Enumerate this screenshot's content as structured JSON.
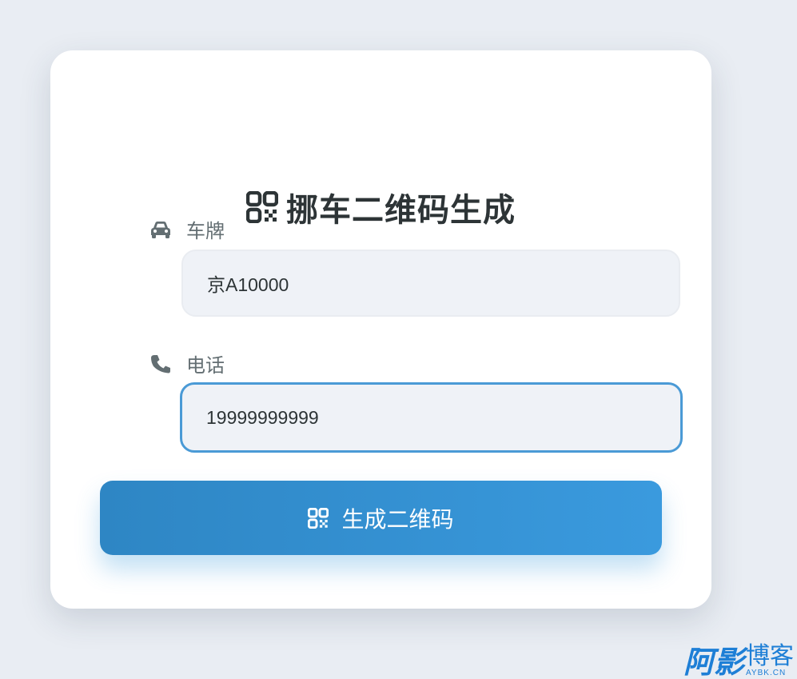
{
  "form": {
    "title": "挪车二维码生成",
    "title_icon": "qrcode-icon",
    "plate": {
      "label": "车牌",
      "icon": "car-icon",
      "value": "京A10000"
    },
    "phone": {
      "label": "电话",
      "icon": "phone-icon",
      "value": "19999999999"
    },
    "submit": {
      "label": "生成二维码",
      "icon": "qrcode-icon"
    }
  },
  "watermark": {
    "brand_main": "阿影",
    "brand_sub": "博客",
    "domain": "AYBK.CN"
  },
  "colors": {
    "background": "#e9edf3",
    "card": "#ffffff",
    "accent": "#3498db",
    "title": "#2d3436",
    "label": "#636e72",
    "input_bg": "#eff2f7",
    "focus_border": "#4a9ad6",
    "watermark": "#1e7fd6"
  }
}
